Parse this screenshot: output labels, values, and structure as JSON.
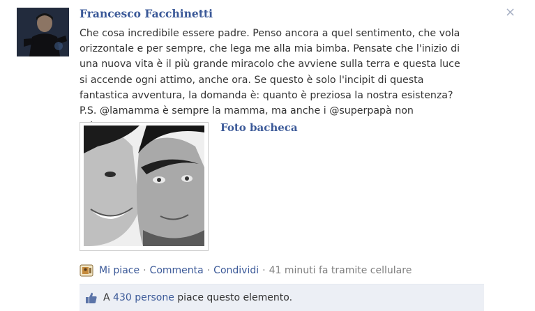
{
  "post": {
    "author": "Francesco Facchinetti",
    "message": "Che cosa incredibile essere padre. Penso ancora a quel sentimento, che vola orizzontale e per sempre, che lega me alla mia bimba. Pensate che l'inizio di una nuova vita è il più grande miracolo che avviene sulla terra e questa luce si accende ogni attimo, anche ora. Se questo è solo l'incipit di questa fantastica avventura, la domanda è: quanto è preziosa la nostra esistenza? P.S. @lamamma è sempre la mamma, ma anche i @superpapà non scherzano.",
    "album_title": "Foto bacheca",
    "close_glyph": "×"
  },
  "actions": {
    "like": "Mi piace",
    "comment": "Commenta",
    "share": "Condividi",
    "separator": "·",
    "timestamp": "41 minuti fa tramite cellulare"
  },
  "likes": {
    "prefix": "A",
    "count_link": "430 persone",
    "suffix": "piace questo elemento."
  },
  "colors": {
    "link": "#3b5998",
    "text": "#333333",
    "meta": "#7f7f7f",
    "likes_bg": "#eceff5"
  },
  "icons": [
    "close-icon",
    "mobile-icon",
    "thumbs-up-icon"
  ]
}
